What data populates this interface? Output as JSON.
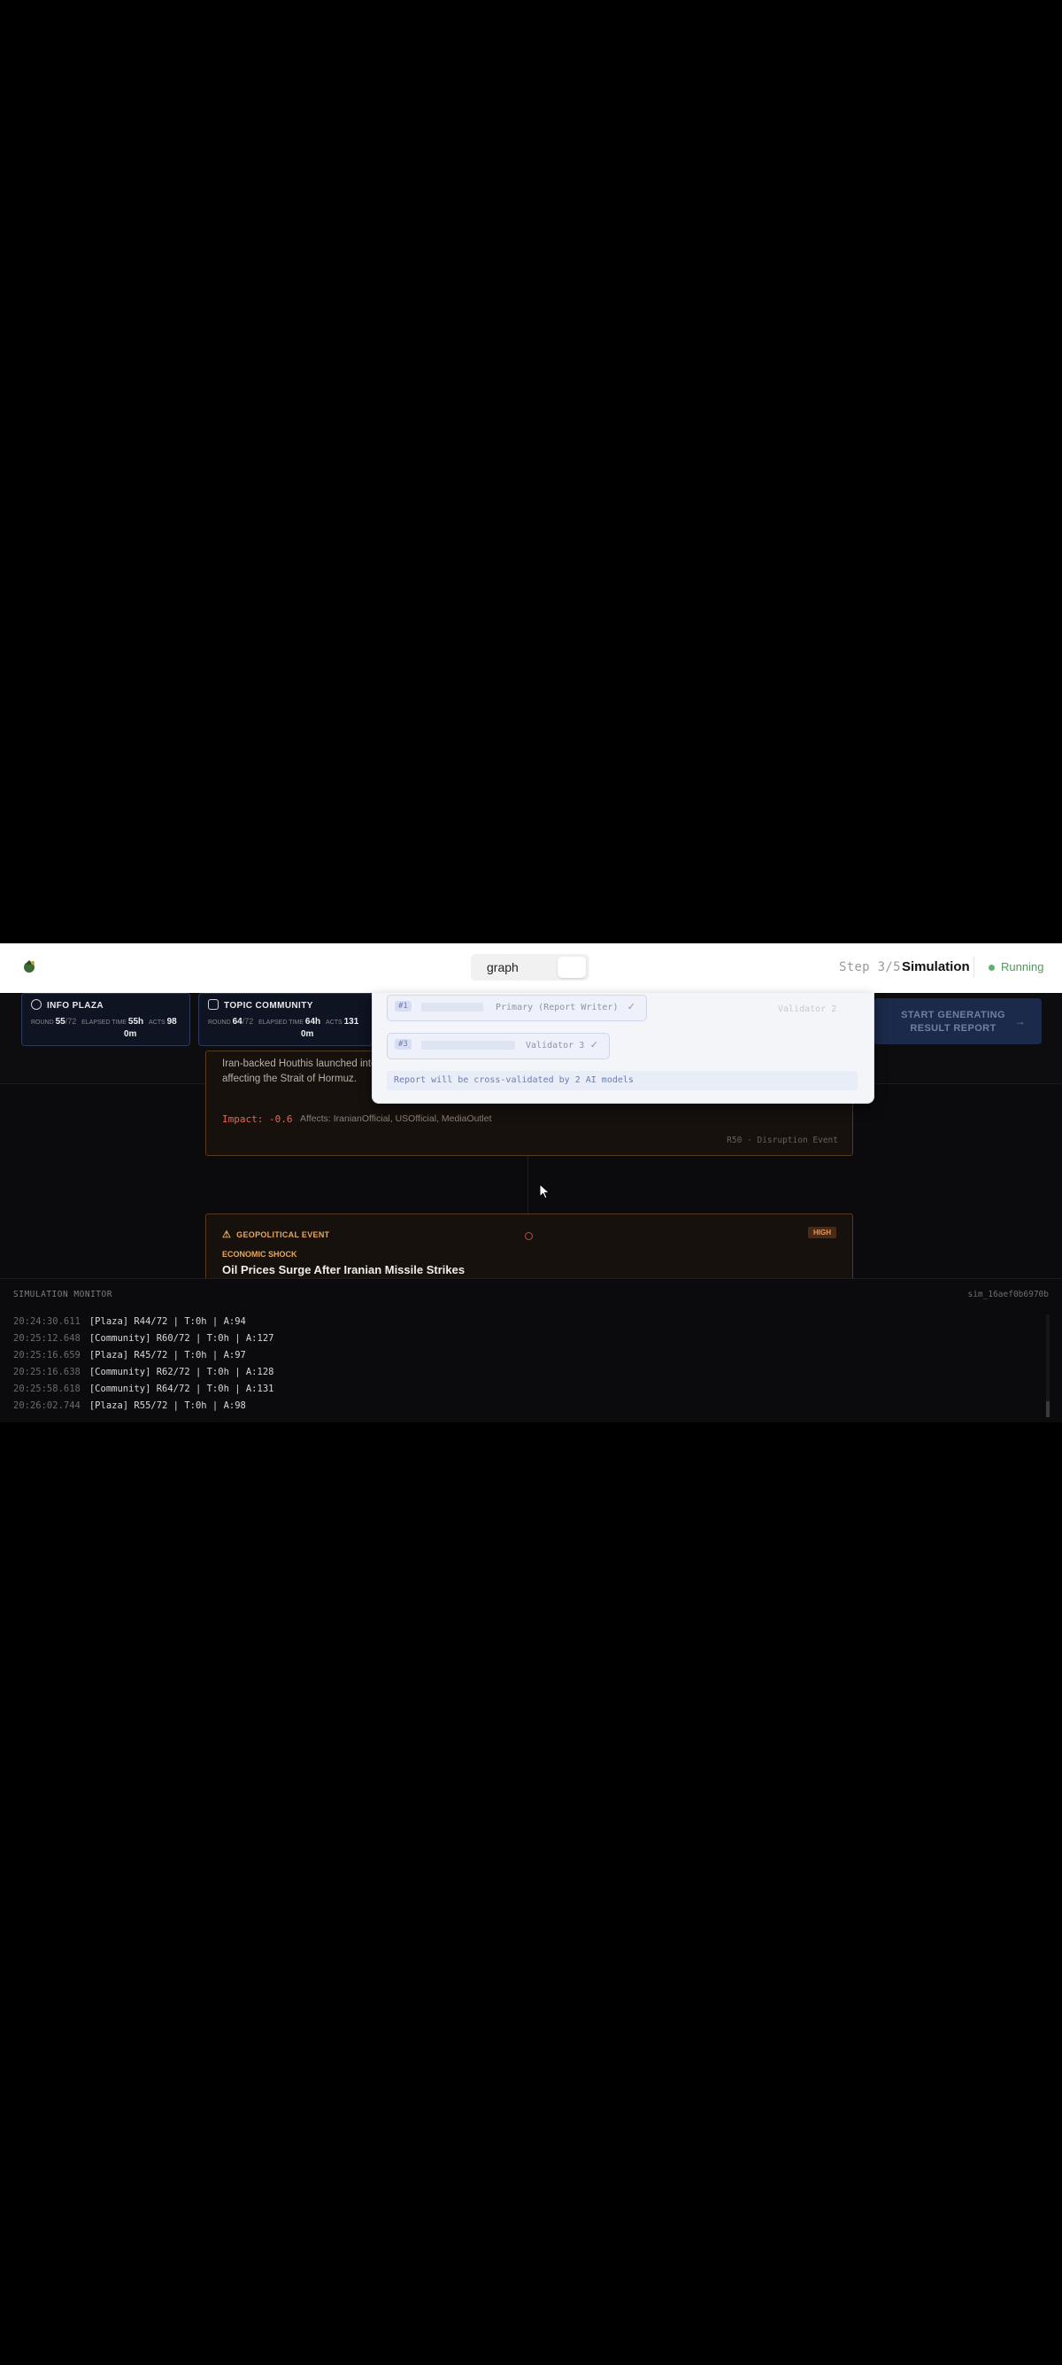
{
  "header": {
    "view_toggle_label": "graph",
    "step_label": "Step 3/5",
    "step_name": "Simulation",
    "status": "Running",
    "status_color": "#5fb36c"
  },
  "stats": {
    "plaza": {
      "title": "INFO PLAZA",
      "round_label": "ROUND",
      "round_value": "55",
      "round_total": "/72",
      "elapsed_label": "ELAPSED TIME",
      "elapsed_value": "55h",
      "elapsed_minutes": "0m",
      "acts_label": "ACTS",
      "acts_value": "98"
    },
    "community": {
      "title": "TOPIC COMMUNITY",
      "round_label": "ROUND",
      "round_value": "64",
      "round_total": "/72",
      "elapsed_label": "ELAPSED TIME",
      "elapsed_value": "64h",
      "elapsed_minutes": "0m",
      "acts_label": "ACTS",
      "acts_value": "131"
    }
  },
  "cta": {
    "label": "START GENERATING RESULT REPORT",
    "arrow": "→"
  },
  "dropdown": {
    "models": [
      {
        "index": "#1",
        "role": "Primary (Report Writer)",
        "check": "✓"
      },
      {
        "index": "#3",
        "role": "Validator 3",
        "check": "✓"
      }
    ],
    "validator_2_label": "Validator 2",
    "note": "Report will be cross-validated by 2 AI models"
  },
  "events": [
    {
      "description": "Iran-backed Houthis launched into the conflict. This action could disrupt shipping routes and impact global oil prices, particularly affecting the Strait of Hormuz.",
      "impact": "Impact: -0.6",
      "affects": "Affects: IranianOfficial, USOfficial, MediaOutlet",
      "round": "R50 · Disruption Event"
    },
    {
      "kind": "GEOPOLITICAL EVENT",
      "badge": "HIGH",
      "category": "ECONOMIC SHOCK",
      "title": "Oil Prices Surge After Iranian Missile Strikes"
    }
  ],
  "monitor": {
    "title": "SIMULATION MONITOR",
    "sim_id": "sim_16aef0b6970b",
    "log": [
      {
        "ts": "20:24:30.611",
        "msg": "[Plaza] R44/72 | T:0h | A:94"
      },
      {
        "ts": "20:25:12.648",
        "msg": "[Community] R60/72 | T:0h | A:127"
      },
      {
        "ts": "20:25:16.659",
        "msg": "[Plaza] R45/72 | T:0h | A:97"
      },
      {
        "ts": "20:25:16.638",
        "msg": "[Community] R62/72 | T:0h | A:128"
      },
      {
        "ts": "20:25:58.618",
        "msg": "[Community] R64/72 | T:0h | A:131"
      },
      {
        "ts": "20:26:02.744",
        "msg": "[Plaza] R55/72 | T:0h | A:98"
      }
    ]
  }
}
